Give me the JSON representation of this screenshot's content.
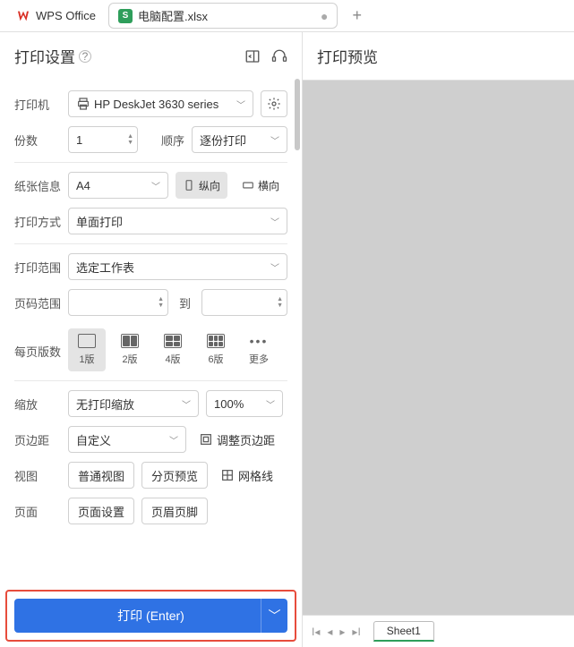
{
  "tabbar": {
    "home": "WPS Office",
    "file": "电脑配置.xlsx"
  },
  "panel": {
    "title": "打印设置",
    "preview": "打印预览"
  },
  "printer": {
    "label": "打印机",
    "value": "HP DeskJet 3630 series"
  },
  "copies": {
    "label": "份数",
    "value": "1",
    "order_label": "顺序",
    "order_value": "逐份打印"
  },
  "paper": {
    "label": "纸张信息",
    "size": "A4",
    "portrait": "纵向",
    "landscape": "横向"
  },
  "method": {
    "label": "打印方式",
    "value": "单面打印"
  },
  "range": {
    "label": "打印范围",
    "value": "选定工作表"
  },
  "pages": {
    "label": "页码范围",
    "to": "到"
  },
  "layout": {
    "label": "每页版数",
    "l1": "1版",
    "l2": "2版",
    "l4": "4版",
    "l6": "6版",
    "more": "更多"
  },
  "scale": {
    "label": "缩放",
    "value": "无打印缩放",
    "pct": "100%"
  },
  "margin": {
    "label": "页边距",
    "value": "自定义",
    "adjust": "调整页边距"
  },
  "view": {
    "label": "视图",
    "normal": "普通视图",
    "page": "分页预览",
    "grid": "网格线"
  },
  "page": {
    "label": "页面",
    "setup": "页面设置",
    "header": "页眉页脚"
  },
  "print_btn": "打印 (Enter)",
  "sheet": "Sheet1"
}
